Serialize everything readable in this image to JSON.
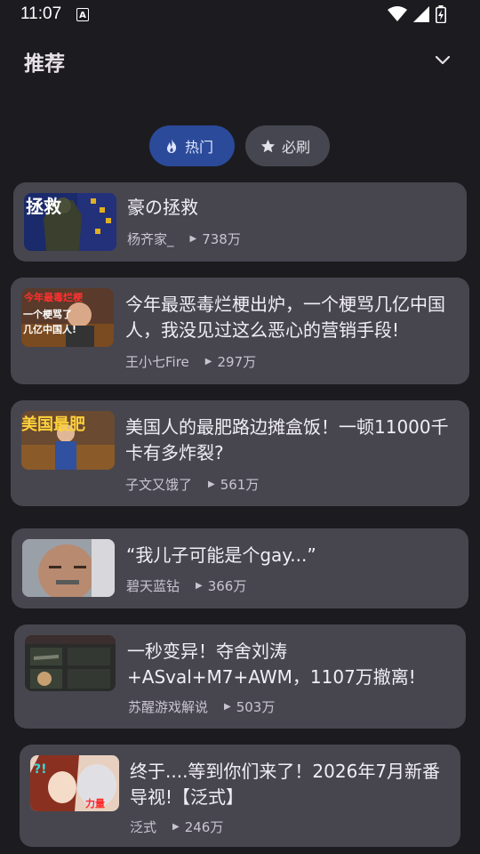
{
  "status": {
    "time": "11:07",
    "a_icon_label": "A"
  },
  "header": {
    "title": "推荐"
  },
  "chips": [
    {
      "label": "热门",
      "icon": "flame-icon",
      "selected": true
    },
    {
      "label": "必刷",
      "icon": "star-icon",
      "selected": false
    }
  ],
  "videos": [
    {
      "title": "豪の拯救",
      "author": "杨齐家_",
      "views": "738万"
    },
    {
      "title": "今年最恶毒烂梗出炉，一个梗骂几亿中国人，我没见过这么恶心的营销手段!",
      "author": "王小七Fire",
      "views": "297万"
    },
    {
      "title": "美国人的最肥路边摊盒饭！一顿11000千卡有多炸裂?",
      "author": "子文又饿了",
      "views": "561万"
    },
    {
      "title": "“我儿子可能是个gay...”",
      "author": "碧天蓝钻",
      "views": "366万"
    },
    {
      "title": "一秒变异！夺舍刘涛+ASval+M7+AWM，1107万撤离!",
      "author": "苏醒游戏解说",
      "views": "503万"
    },
    {
      "title": "终于....等到你们来了！2026年7月新番导视!【泛式】",
      "author": "泛式",
      "views": "246万"
    }
  ],
  "thumb_text": {
    "t1": "拯救",
    "t2_top": "今年最毒烂梗",
    "t2_mid": "一个梗骂了",
    "t2_bot": "几亿中国人!",
    "t3": "美国最肥",
    "t6": "力量"
  },
  "colors": {
    "background": "#1c1b1f",
    "card": "#47464f",
    "chip_selected": "#2b4a9a",
    "chip": "#45464f"
  }
}
